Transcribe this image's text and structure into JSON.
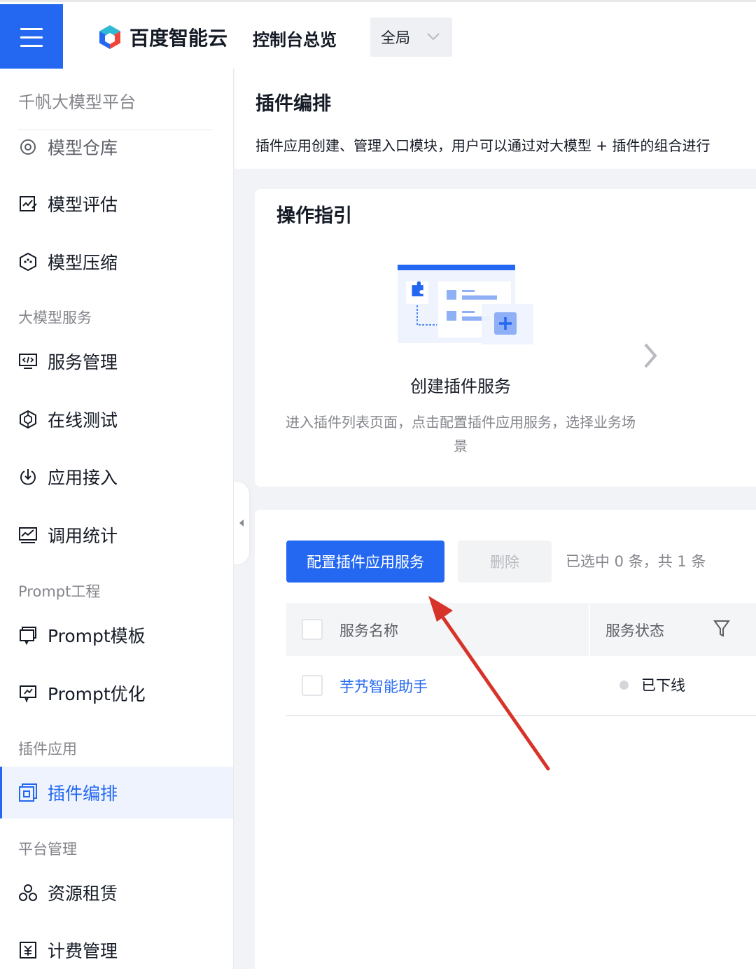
{
  "topbar": {
    "logo_text": "百度智能云",
    "title": "控制台总览",
    "region": "全局"
  },
  "sidebar": {
    "header": "千帆大模型平台",
    "clipped_item": "模型仓库",
    "items_top": [
      {
        "label": "模型评估",
        "icon": "model-eval-icon"
      },
      {
        "label": "模型压缩",
        "icon": "model-compress-icon"
      }
    ],
    "group_service": "大模型服务",
    "items_service": [
      {
        "label": "服务管理",
        "icon": "service-manage-icon"
      },
      {
        "label": "在线测试",
        "icon": "online-test-icon"
      },
      {
        "label": "应用接入",
        "icon": "app-access-icon"
      },
      {
        "label": "调用统计",
        "icon": "call-stats-icon"
      }
    ],
    "group_prompt": "Prompt工程",
    "items_prompt": [
      {
        "label": "Prompt模板",
        "icon": "prompt-template-icon"
      },
      {
        "label": "Prompt优化",
        "icon": "prompt-optimize-icon"
      }
    ],
    "group_plugin": "插件应用",
    "active_item": {
      "label": "插件编排",
      "icon": "plugin-orchestration-icon"
    },
    "group_platform": "平台管理",
    "items_platform": [
      {
        "label": "资源租赁",
        "icon": "resource-lease-icon"
      },
      {
        "label": "计费管理",
        "icon": "billing-icon"
      }
    ]
  },
  "page": {
    "title": "插件编排",
    "description": "插件应用创建、管理入口模块，用户可以通过对大模型 + 插件的组合进行"
  },
  "guide": {
    "title": "操作指引",
    "step_title": "创建插件服务",
    "step_desc": "进入插件列表页面，点击配置插件应用服务，选择业务场景"
  },
  "list": {
    "primary_button": "配置插件应用服务",
    "delete_button": "删除",
    "selection_info": "已选中 0 条，共 1 条",
    "columns": [
      "服务名称",
      "服务状态"
    ],
    "rows": [
      {
        "name": "芋艿智能助手",
        "status": "已下线"
      }
    ]
  },
  "colors": {
    "accent": "#2468f2",
    "annotation_arrow": "#d8332a"
  }
}
